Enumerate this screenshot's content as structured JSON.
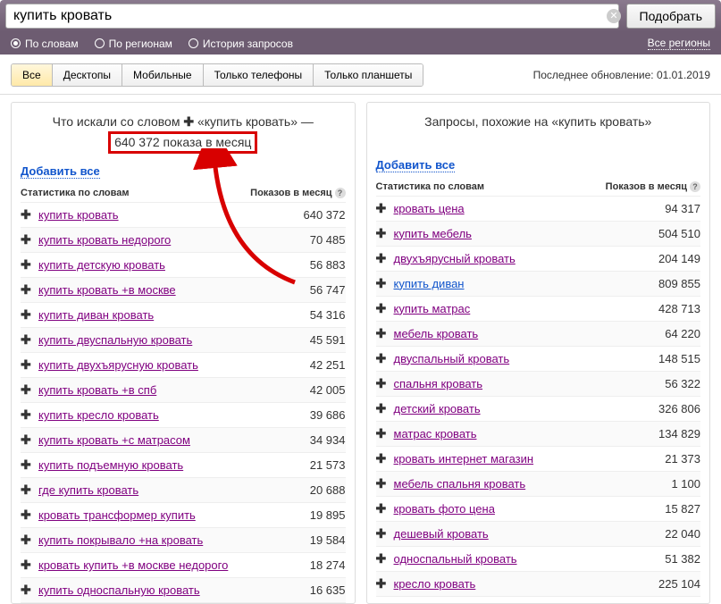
{
  "search": {
    "value": "купить кровать",
    "button": "Подобрать"
  },
  "options": {
    "by_words": "По словам",
    "by_regions": "По регионам",
    "history": "История запросов",
    "all_regions": "Все регионы"
  },
  "tabs": {
    "all": "Все",
    "desktops": "Десктопы",
    "mobile": "Мобильные",
    "phones": "Только телефоны",
    "tablets": "Только планшеты"
  },
  "last_update": {
    "label": "Последнее обновление:",
    "date": "01.01.2019"
  },
  "left": {
    "title_prefix": "Что искали со словом",
    "title_query": "«купить кровать»",
    "title_dash": " — ",
    "stats": "640 372 показа в месяц",
    "add_all": "Добавить все",
    "th_word": "Статистика по словам",
    "th_count": "Показов в месяц",
    "rows": [
      {
        "word": "купить кровать",
        "count": "640 372"
      },
      {
        "word": "купить кровать недорого",
        "count": "70 485"
      },
      {
        "word": "купить детскую кровать",
        "count": "56 883"
      },
      {
        "word": "купить кровать +в москве",
        "count": "56 747"
      },
      {
        "word": "купить диван кровать",
        "count": "54 316"
      },
      {
        "word": "купить двуспальную кровать",
        "count": "45 591"
      },
      {
        "word": "купить двухъярусную кровать",
        "count": "42 251"
      },
      {
        "word": "купить кровать +в спб",
        "count": "42 005"
      },
      {
        "word": "купить кресло кровать",
        "count": "39 686"
      },
      {
        "word": "купить кровать +с матрасом",
        "count": "34 934"
      },
      {
        "word": "купить подъемную кровать",
        "count": "21 573"
      },
      {
        "word": "где купить кровать",
        "count": "20 688"
      },
      {
        "word": "кровать трансформер купить",
        "count": "19 895"
      },
      {
        "word": "купить покрывало +на кровать",
        "count": "19 584"
      },
      {
        "word": "кровать купить +в москве недорого",
        "count": "18 274"
      },
      {
        "word": "купить односпальную кровать",
        "count": "16 635"
      }
    ]
  },
  "right": {
    "title": "Запросы, похожие на «купить кровать»",
    "add_all": "Добавить все",
    "th_word": "Статистика по словам",
    "th_count": "Показов в месяц",
    "rows": [
      {
        "word": "кровать цена",
        "count": "94 317"
      },
      {
        "word": "купить мебель",
        "count": "504 510"
      },
      {
        "word": "двухъярусный кровать",
        "count": "204 149"
      },
      {
        "word": "купить диван",
        "count": "809 855",
        "fresh": true
      },
      {
        "word": "купить матрас",
        "count": "428 713"
      },
      {
        "word": "мебель кровать",
        "count": "64 220"
      },
      {
        "word": "двуспальный кровать",
        "count": "148 515"
      },
      {
        "word": "спальня кровать",
        "count": "56 322"
      },
      {
        "word": "детский кровать",
        "count": "326 806"
      },
      {
        "word": "матрас кровать",
        "count": "134 829"
      },
      {
        "word": "кровать интернет магазин",
        "count": "21 373"
      },
      {
        "word": "мебель спальня кровать",
        "count": "1 100"
      },
      {
        "word": "кровать фото цена",
        "count": "15 827"
      },
      {
        "word": "дешевый кровать",
        "count": "22 040"
      },
      {
        "word": "односпальный кровать",
        "count": "51 382"
      },
      {
        "word": "кресло кровать",
        "count": "225 104"
      }
    ]
  }
}
